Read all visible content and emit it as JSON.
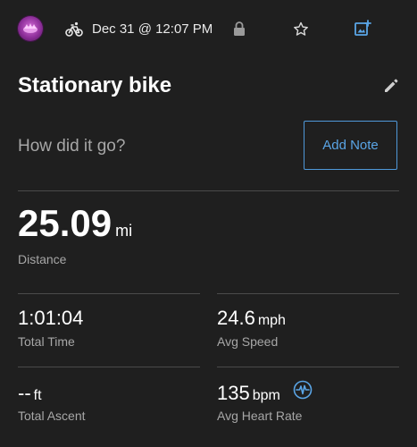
{
  "header": {
    "activity_datetime": "Dec 31 @ 12:07 PM",
    "icons": [
      "avatar",
      "bike-icon",
      "lock-icon",
      "star-icon",
      "add-photo-icon"
    ]
  },
  "activity": {
    "title": "Stationary bike",
    "note_prompt": "How did it go?",
    "add_note_label": "Add Note"
  },
  "stats": {
    "distance": {
      "value": "25.09",
      "unit": "mi",
      "label": "Distance"
    },
    "total_time": {
      "value": "1:01:04",
      "unit": "",
      "label": "Total Time"
    },
    "avg_speed": {
      "value": "24.6",
      "unit": "mph",
      "label": "Avg Speed"
    },
    "total_ascent": {
      "value": "--",
      "unit": "ft",
      "label": "Total Ascent"
    },
    "avg_heart_rate": {
      "value": "135",
      "unit": "bpm",
      "label": "Avg Heart Rate"
    }
  },
  "colors": {
    "background": "#1f1f1f",
    "accent": "#5aa5e6",
    "label": "#a7a7a7",
    "divider": "#4a4a4a"
  }
}
